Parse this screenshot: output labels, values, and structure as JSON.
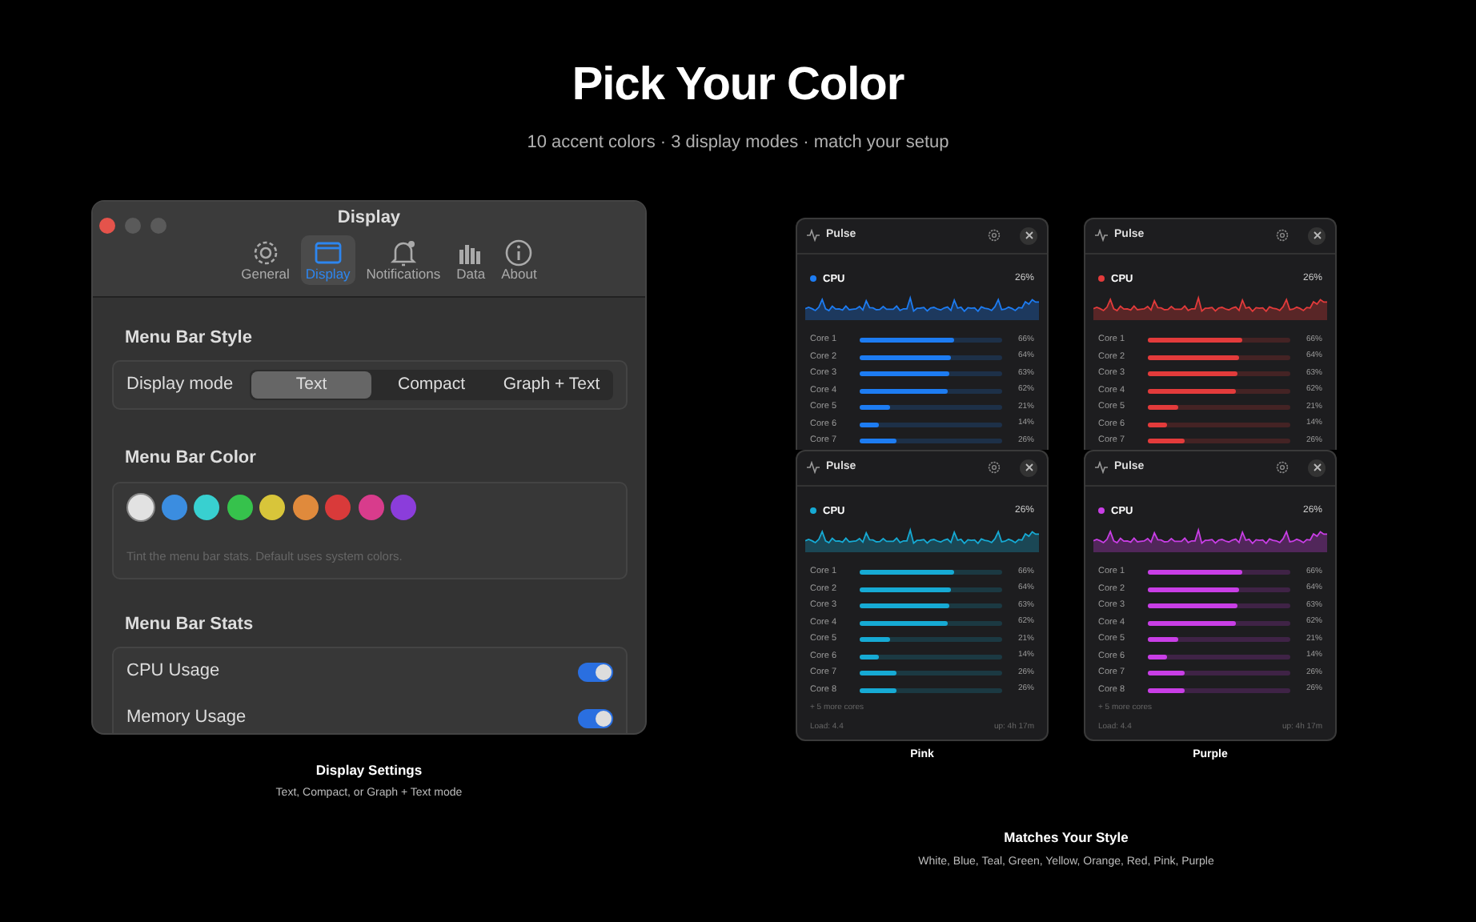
{
  "hero": {
    "title": "Pick Your Color",
    "subtitle": "10 accent colors · 3 display modes · match your setup"
  },
  "settings_window": {
    "title": "Display",
    "tabs": [
      {
        "label": "General",
        "kind": "gear",
        "selected": false
      },
      {
        "label": "Display",
        "kind": "window",
        "selected": true
      },
      {
        "label": "Notifications",
        "kind": "bell",
        "selected": false
      },
      {
        "label": "Data",
        "kind": "bars",
        "selected": false
      },
      {
        "label": "About",
        "kind": "info",
        "selected": false
      }
    ],
    "style_section": {
      "heading": "Menu Bar Style",
      "label": "Display mode",
      "modes": [
        {
          "label": "Text",
          "selected": true
        },
        {
          "label": "Compact",
          "selected": false
        },
        {
          "label": "Graph + Text",
          "selected": false
        }
      ]
    },
    "color_section": {
      "heading": "Menu Bar Color",
      "swatches": [
        {
          "color": "#e2e2e2",
          "selected": true
        },
        {
          "color": "#3b8de0",
          "selected": false
        },
        {
          "color": "#38d0d0",
          "selected": false
        },
        {
          "color": "#36c24c",
          "selected": false
        },
        {
          "color": "#d8c53a",
          "selected": false
        },
        {
          "color": "#e08a3c",
          "selected": false
        },
        {
          "color": "#d93a3a",
          "selected": false
        },
        {
          "color": "#d83c8c",
          "selected": false
        },
        {
          "color": "#8b3ddb",
          "selected": false
        }
      ],
      "hint": "Tint the menu bar stats. Default uses system colors."
    },
    "stats_section": {
      "heading": "Menu Bar Stats",
      "rows": [
        {
          "label": "CPU Usage",
          "on": true
        },
        {
          "label": "Memory Usage",
          "on": true
        }
      ]
    }
  },
  "settings_caption": {
    "title": "Display Settings",
    "subtitle": "Text, Compact, or Graph + Text mode"
  },
  "panels": [
    {
      "color": "#1d7cf2",
      "title": "Pulse",
      "metric": "CPU",
      "reading": "26%",
      "cores": [
        {
          "name": "Core 1",
          "level": 0.66,
          "reading": "66%"
        },
        {
          "name": "Core 2",
          "level": 0.64,
          "reading": "64%"
        },
        {
          "name": "Core 3",
          "level": 0.63,
          "reading": "63%"
        },
        {
          "name": "Core 4",
          "level": 0.62,
          "reading": "62%"
        },
        {
          "name": "Core 5",
          "level": 0.21,
          "reading": "21%"
        },
        {
          "name": "Core 6",
          "level": 0.14,
          "reading": "14%"
        },
        {
          "name": "Core 7",
          "level": 0.26,
          "reading": "26%"
        }
      ]
    },
    {
      "color": "#e33b3b",
      "title": "Pulse",
      "metric": "CPU",
      "reading": "26%",
      "cores": [
        {
          "name": "Core 1",
          "level": 0.66,
          "reading": "66%"
        },
        {
          "name": "Core 2",
          "level": 0.64,
          "reading": "64%"
        },
        {
          "name": "Core 3",
          "level": 0.63,
          "reading": "63%"
        },
        {
          "name": "Core 4",
          "level": 0.62,
          "reading": "62%"
        },
        {
          "name": "Core 5",
          "level": 0.21,
          "reading": "21%"
        },
        {
          "name": "Core 6",
          "level": 0.14,
          "reading": "14%"
        },
        {
          "name": "Core 7",
          "level": 0.26,
          "reading": "26%"
        }
      ]
    },
    {
      "color": "#16aad4",
      "title": "Pulse",
      "metric": "CPU",
      "reading": "26%",
      "cores": [
        {
          "name": "Core 1",
          "level": 0.66,
          "reading": "66%"
        },
        {
          "name": "Core 2",
          "level": 0.64,
          "reading": "64%"
        },
        {
          "name": "Core 3",
          "level": 0.63,
          "reading": "63%"
        },
        {
          "name": "Core 4",
          "level": 0.62,
          "reading": "62%"
        },
        {
          "name": "Core 5",
          "level": 0.21,
          "reading": "21%"
        },
        {
          "name": "Core 6",
          "level": 0.14,
          "reading": "14%"
        },
        {
          "name": "Core 7",
          "level": 0.26,
          "reading": "26%"
        },
        {
          "name": "Core 8",
          "level": 0.26,
          "reading": "26%"
        }
      ],
      "more": "+ 5 more cores",
      "load": "Load: 4.4",
      "uptime": "up: 4h 17m",
      "label": "Pink"
    },
    {
      "color": "#c93ee6",
      "title": "Pulse",
      "metric": "CPU",
      "reading": "26%",
      "cores": [
        {
          "name": "Core 1",
          "level": 0.66,
          "reading": "66%"
        },
        {
          "name": "Core 2",
          "level": 0.64,
          "reading": "64%"
        },
        {
          "name": "Core 3",
          "level": 0.63,
          "reading": "63%"
        },
        {
          "name": "Core 4",
          "level": 0.62,
          "reading": "62%"
        },
        {
          "name": "Core 5",
          "level": 0.21,
          "reading": "21%"
        },
        {
          "name": "Core 6",
          "level": 0.14,
          "reading": "14%"
        },
        {
          "name": "Core 7",
          "level": 0.26,
          "reading": "26%"
        },
        {
          "name": "Core 8",
          "level": 0.26,
          "reading": "26%"
        }
      ],
      "more": "+ 5 more cores",
      "load": "Load: 4.4",
      "uptime": "up: 4h 17m",
      "label": "Purple"
    }
  ],
  "panels_caption": {
    "title": "Matches Your Style",
    "subtitle": "White, Blue, Teal, Green, Yellow, Orange, Red, Pink, Purple"
  }
}
